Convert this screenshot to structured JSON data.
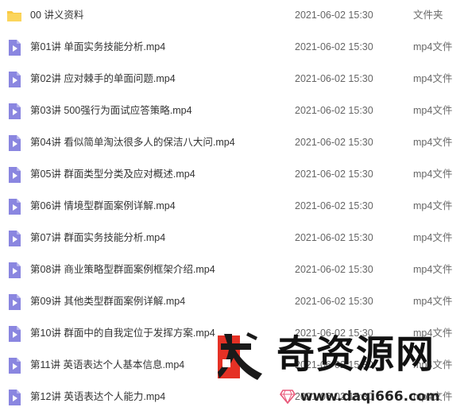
{
  "files": [
    {
      "name": "00 讲义资料",
      "date": "2021-06-02 15:30",
      "type": "文件夹",
      "icon": "folder-icon"
    },
    {
      "name": "第01讲 单面实务技能分析.mp4",
      "date": "2021-06-02 15:30",
      "type": "mp4文件",
      "icon": "video-file-icon"
    },
    {
      "name": "第02讲 应对棘手的单面问题.mp4",
      "date": "2021-06-02 15:30",
      "type": "mp4文件",
      "icon": "video-file-icon"
    },
    {
      "name": "第03讲 500强行为面试应答策略.mp4",
      "date": "2021-06-02 15:30",
      "type": "mp4文件",
      "icon": "video-file-icon"
    },
    {
      "name": "第04讲 看似简单淘汰很多人的保洁八大问.mp4",
      "date": "2021-06-02 15:30",
      "type": "mp4文件",
      "icon": "video-file-icon"
    },
    {
      "name": "第05讲 群面类型分类及应对概述.mp4",
      "date": "2021-06-02 15:30",
      "type": "mp4文件",
      "icon": "video-file-icon"
    },
    {
      "name": "第06讲 情境型群面案例详解.mp4",
      "date": "2021-06-02 15:30",
      "type": "mp4文件",
      "icon": "video-file-icon"
    },
    {
      "name": "第07讲 群面实务技能分析.mp4",
      "date": "2021-06-02 15:30",
      "type": "mp4文件",
      "icon": "video-file-icon"
    },
    {
      "name": "第08讲 商业策略型群面案例框架介绍.mp4",
      "date": "2021-06-02 15:30",
      "type": "mp4文件",
      "icon": "video-file-icon"
    },
    {
      "name": "第09讲 其他类型群面案例详解.mp4",
      "date": "2021-06-02 15:30",
      "type": "mp4文件",
      "icon": "video-file-icon"
    },
    {
      "name": "第10讲 群面中的自我定位于发挥方案.mp4",
      "date": "2021-06-02 15:30",
      "type": "mp4文件",
      "icon": "video-file-icon"
    },
    {
      "name": "第11讲 英语表达个人基本信息.mp4",
      "date": "2021-06-02 15:30",
      "type": "mp4文件",
      "icon": "video-file-icon"
    },
    {
      "name": "第12讲 英语表达个人能力.mp4",
      "date": "2021-06-02 15:30",
      "type": "mp4文件",
      "icon": "video-file-icon"
    }
  ],
  "watermark": {
    "brand": "奇资源网",
    "url": "www.daqi666.com",
    "logo_icon": "da-logo-icon",
    "url_icon": "diamond-icon"
  },
  "colors": {
    "folder": "#f9c943",
    "video_icon": "#8a86e0",
    "text": "#333333",
    "meta_text": "#666666",
    "logo_red": "#e53125",
    "logo_dark": "#1a1a1a",
    "diamond": "#e8597a"
  }
}
